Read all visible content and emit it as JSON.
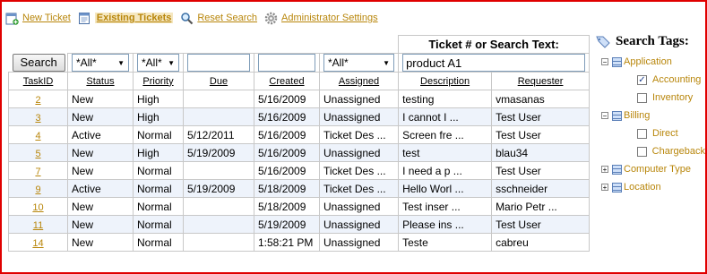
{
  "nav": {
    "new_ticket": "New Ticket",
    "existing_tickets": "Existing Tickets",
    "reset_search": "Reset Search",
    "admin_settings": "Administrator Settings"
  },
  "search": {
    "header": "Ticket # or Search Text:",
    "button": "Search",
    "status_filter": "*All*",
    "priority_filter": "*All*",
    "due_filter": "",
    "created_filter": "",
    "assigned_filter": "*All*",
    "text_value": "product A1"
  },
  "columns": [
    "TaskID",
    "Status",
    "Priority",
    "Due",
    "Created",
    "Assigned",
    "Description",
    "Requester"
  ],
  "rows": [
    {
      "id": "2",
      "status": "New",
      "priority": "High",
      "due": "",
      "created": "5/16/2009",
      "assigned": "Unassigned",
      "description": "testing",
      "requester": "vmasanas"
    },
    {
      "id": "3",
      "status": "New",
      "priority": "High",
      "due": "",
      "created": "5/16/2009",
      "assigned": "Unassigned",
      "description": "I cannot I ...",
      "requester": "Test User"
    },
    {
      "id": "4",
      "status": "Active",
      "priority": "Normal",
      "due": "5/12/2011",
      "created": "5/16/2009",
      "assigned": "Ticket Des ...",
      "description": "Screen fre ...",
      "requester": "Test User"
    },
    {
      "id": "5",
      "status": "New",
      "priority": "High",
      "due": "5/19/2009",
      "created": "5/16/2009",
      "assigned": "Unassigned",
      "description": "test",
      "requester": "blau34"
    },
    {
      "id": "7",
      "status": "New",
      "priority": "Normal",
      "due": "",
      "created": "5/16/2009",
      "assigned": "Ticket Des ...",
      "description": "I need a p ...",
      "requester": "Test User"
    },
    {
      "id": "9",
      "status": "Active",
      "priority": "Normal",
      "due": "5/19/2009",
      "created": "5/18/2009",
      "assigned": "Ticket Des ...",
      "description": "Hello Worl ...",
      "requester": "sschneider"
    },
    {
      "id": "10",
      "status": "New",
      "priority": "Normal",
      "due": "",
      "created": "5/18/2009",
      "assigned": "Unassigned",
      "description": "Test inser ...",
      "requester": "Mario Petr ..."
    },
    {
      "id": "11",
      "status": "New",
      "priority": "Normal",
      "due": "",
      "created": "5/19/2009",
      "assigned": "Unassigned",
      "description": "Please ins ...",
      "requester": "Test User"
    },
    {
      "id": "14",
      "status": "New",
      "priority": "Normal",
      "due": "",
      "created": "1:58:21 PM",
      "assigned": "Unassigned",
      "description": "Teste",
      "requester": "cabreu"
    }
  ],
  "tags": {
    "title": "Search Tags:",
    "application": "Application",
    "accounting": "Accounting",
    "inventory": "Inventory",
    "billing": "Billing",
    "direct": "Direct",
    "chargeback": "Chargeback",
    "computer_type": "Computer Type",
    "location": "Location"
  },
  "colors": {
    "frame": "#e00000",
    "link": "#b8860b",
    "alt_row": "#eef3fb"
  }
}
